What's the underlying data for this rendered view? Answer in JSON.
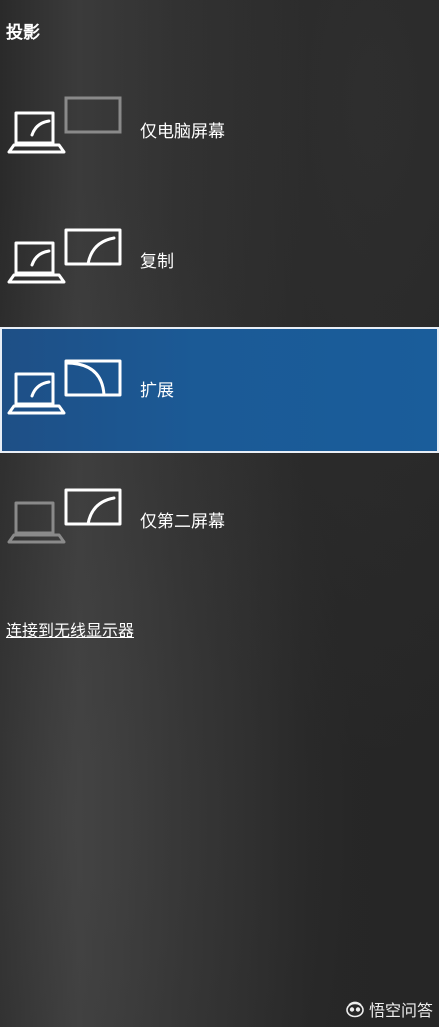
{
  "panel": {
    "title": "投影",
    "options": [
      {
        "label": "仅电脑屏幕",
        "icon": "pc-screen-only-icon",
        "selected": false
      },
      {
        "label": "复制",
        "icon": "duplicate-icon",
        "selected": false
      },
      {
        "label": "扩展",
        "icon": "extend-icon",
        "selected": true
      },
      {
        "label": "仅第二屏幕",
        "icon": "second-screen-only-icon",
        "selected": false
      }
    ],
    "wireless_link": "连接到无线显示器"
  },
  "watermark": {
    "text": "悟空问答",
    "icon": "wukong-logo-icon"
  },
  "colors": {
    "background": "#2d2d2d",
    "selected_background": "#1b5a96",
    "selected_border": "#e8eef6",
    "icon_active": "#ffffff",
    "icon_dimmed": "#8a8a8a"
  }
}
